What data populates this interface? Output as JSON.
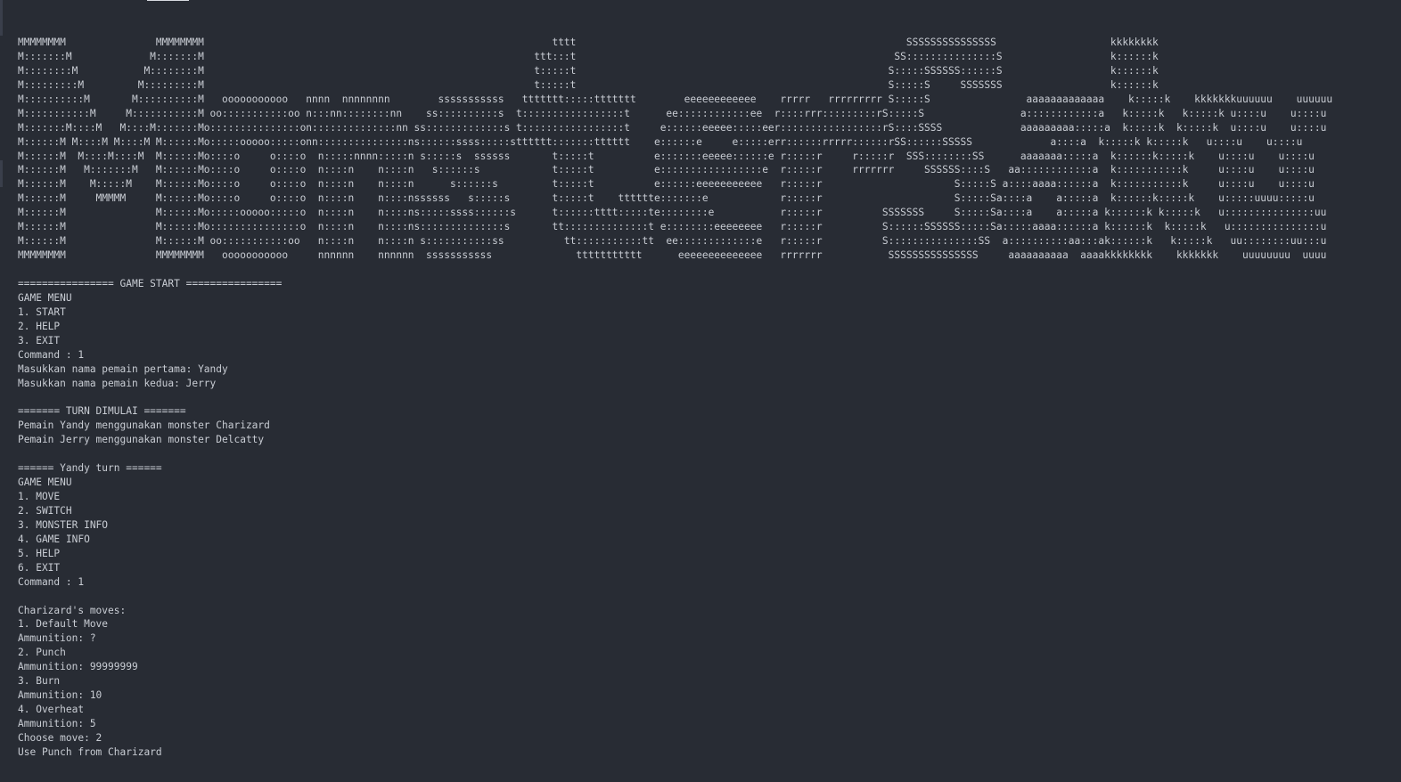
{
  "terminal": {
    "lines": [
      "MMMMMMMM               MMMMMMMM                                                          tttt                                                       SSSSSSSSSSSSSSS                   kkkkkkkk",
      "M:::::::M             M:::::::M                                                       ttt:::t                                                     SS:::::::::::::::S                  k::::::k",
      "M::::::::M           M::::::::M                                                       t:::::t                                                    S:::::SSSSSS::::::S                  k::::::k",
      "M:::::::::M         M:::::::::M                                                       t:::::t                                                    S:::::S     SSSSSSS                  k::::::k",
      "M::::::::::M       M::::::::::M   ooooooooooo   nnnn  nnnnnnnn        sssssssssss   ttttttt:::::ttttttt        eeeeeeeeeeee    rrrrr   rrrrrrrrr S:::::S                aaaaaaaaaaaaa    k:::::k    kkkkkkkuuuuuu    uuuuuu",
      "M:::::::::::M     M:::::::::::M oo:::::::::::oo n:::nn::::::::nn    ss::::::::::s  t:::::::::::::::::t      ee::::::::::::ee  r::::rrr:::::::::rS:::::S                a::::::::::::a   k:::::k   k:::::k u::::u    u::::u",
      "M:::::::M::::M   M::::M:::::::Mo:::::::::::::::on::::::::::::::nn ss:::::::::::::s t:::::::::::::::::t     e::::::eeeee:::::eer:::::::::::::::::rS::::SSSS             aaaaaaaaa:::::a  k:::::k  k:::::k  u::::u    u::::u",
      "M::::::M M::::M M::::M M::::::Mo:::::ooooo:::::onn:::::::::::::::ns::::::ssss:::::stttttt:::::::tttttt    e::::::e     e:::::err::::::rrrrr::::::rSS::::::SSSSS             a::::a  k:::::k k:::::k   u::::u    u::::u",
      "M::::::M  M::::M::::M  M::::::Mo::::o     o::::o  n:::::nnnn:::::n s:::::s  ssssss       t:::::t          e:::::::eeeee::::::e r:::::r     r:::::r  SSS::::::::SS      aaaaaaa:::::a  k::::::k:::::k    u::::u    u::::u",
      "M::::::M   M:::::::M   M::::::Mo::::o     o::::o  n::::n    n::::n   s::::::s            t:::::t          e:::::::::::::::::e  r:::::r     rrrrrrr     SSSSSS::::S   aa::::::::::::a  k:::::::::::k     u::::u    u::::u",
      "M::::::M    M:::::M    M::::::Mo::::o     o::::o  n::::n    n::::n      s::::::s         t:::::t          e::::::eeeeeeeeeee   r:::::r                      S:::::S a::::aaaa::::::a  k:::::::::::k     u::::u    u::::u",
      "M::::::M     MMMMM     M::::::Mo::::o     o::::o  n::::n    n::::nssssss   s:::::s       t:::::t    tttttte:::::::e            r:::::r                      S:::::Sa::::a    a:::::a  k::::::k:::::k    u:::::uuuu:::::u",
      "M::::::M               M::::::Mo:::::ooooo:::::o  n::::n    n::::ns:::::ssss::::::s      t::::::tttt:::::te::::::::e           r:::::r          SSSSSSS     S:::::Sa::::a    a:::::a k::::::k k:::::k   u:::::::::::::::uu",
      "M::::::M               M::::::Mo:::::::::::::::o  n::::n    n::::ns::::::::::::::s       tt::::::::::::::t e::::::::eeeeeeee   r:::::r          S::::::SSSSSS:::::Sa:::::aaaa::::::a k::::::k  k:::::k   u:::::::::::::::u",
      "M::::::M               M::::::M oo:::::::::::oo   n::::n    n::::n s:::::::::::ss          tt:::::::::::tt  ee:::::::::::::e   r:::::r          S:::::::::::::::SS  a::::::::::aa:::ak::::::k   k:::::k   uu::::::::uu:::u",
      "MMMMMMMM               MMMMMMMM   ooooooooooo     nnnnnn    nnnnnn  sssssssssss              ttttttttttt      eeeeeeeeeeeeee   rrrrrrr           SSSSSSSSSSSSSSS     aaaaaaaaaa  aaaakkkkkkkk    kkkkkkk    uuuuuuuu  uuuu",
      "",
      "================ GAME START ================",
      "GAME MENU",
      "1. START",
      "2. HELP",
      "3. EXIT",
      "Command : 1",
      "Masukkan nama pemain pertama: Yandy",
      "Masukkan nama pemain kedua: Jerry",
      "",
      "======= TURN DIMULAI =======",
      "Pemain Yandy menggunakan monster Charizard",
      "Pemain Jerry menggunakan monster Delcatty",
      "",
      "====== Yandy turn ======",
      "GAME MENU",
      "1. MOVE",
      "2. SWITCH",
      "3. MONSTER INFO",
      "4. GAME INFO",
      "5. HELP",
      "6. EXIT",
      "Command : 1",
      "",
      "Charizard's moves:",
      "1. Default Move",
      "Ammunition: ?",
      "2. Punch",
      "Ammunition: 99999999",
      "3. Burn",
      "Ammunition: 10",
      "4. Overheat",
      "Ammunition: 5",
      "Choose move: 2",
      "Use Punch from Charizard"
    ]
  },
  "colors": {
    "background": "#282c34",
    "text": "#c9cdd4"
  }
}
